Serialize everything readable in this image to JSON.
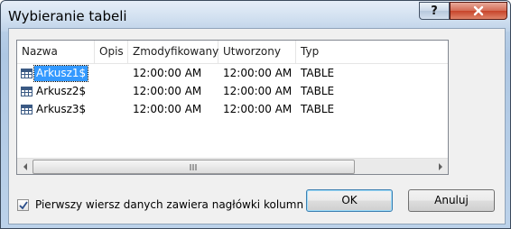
{
  "dialog": {
    "title": "Wybieranie tabeli",
    "help_label": "?"
  },
  "table": {
    "columns": [
      "Nazwa",
      "Opis",
      "Zmodyfikowany",
      "Utworzony",
      "Typ"
    ],
    "rows": [
      {
        "name": "Arkusz1$",
        "desc": "",
        "modified": "12:00:00 AM",
        "created": "12:00:00 AM",
        "type": "TABLE",
        "selected": true
      },
      {
        "name": "Arkusz2$",
        "desc": "",
        "modified": "12:00:00 AM",
        "created": "12:00:00 AM",
        "type": "TABLE",
        "selected": false
      },
      {
        "name": "Arkusz3$",
        "desc": "",
        "modified": "12:00:00 AM",
        "created": "12:00:00 AM",
        "type": "TABLE",
        "selected": false
      }
    ]
  },
  "options": {
    "first_row_headers_label": "Pierwszy wiersz danych zawiera nagłówki kolumn",
    "first_row_headers_checked": true
  },
  "buttons": {
    "ok_label": "OK",
    "cancel_label": "Anuluj"
  },
  "colors": {
    "selection": "#3399ff",
    "close_button": "#c7442a"
  }
}
